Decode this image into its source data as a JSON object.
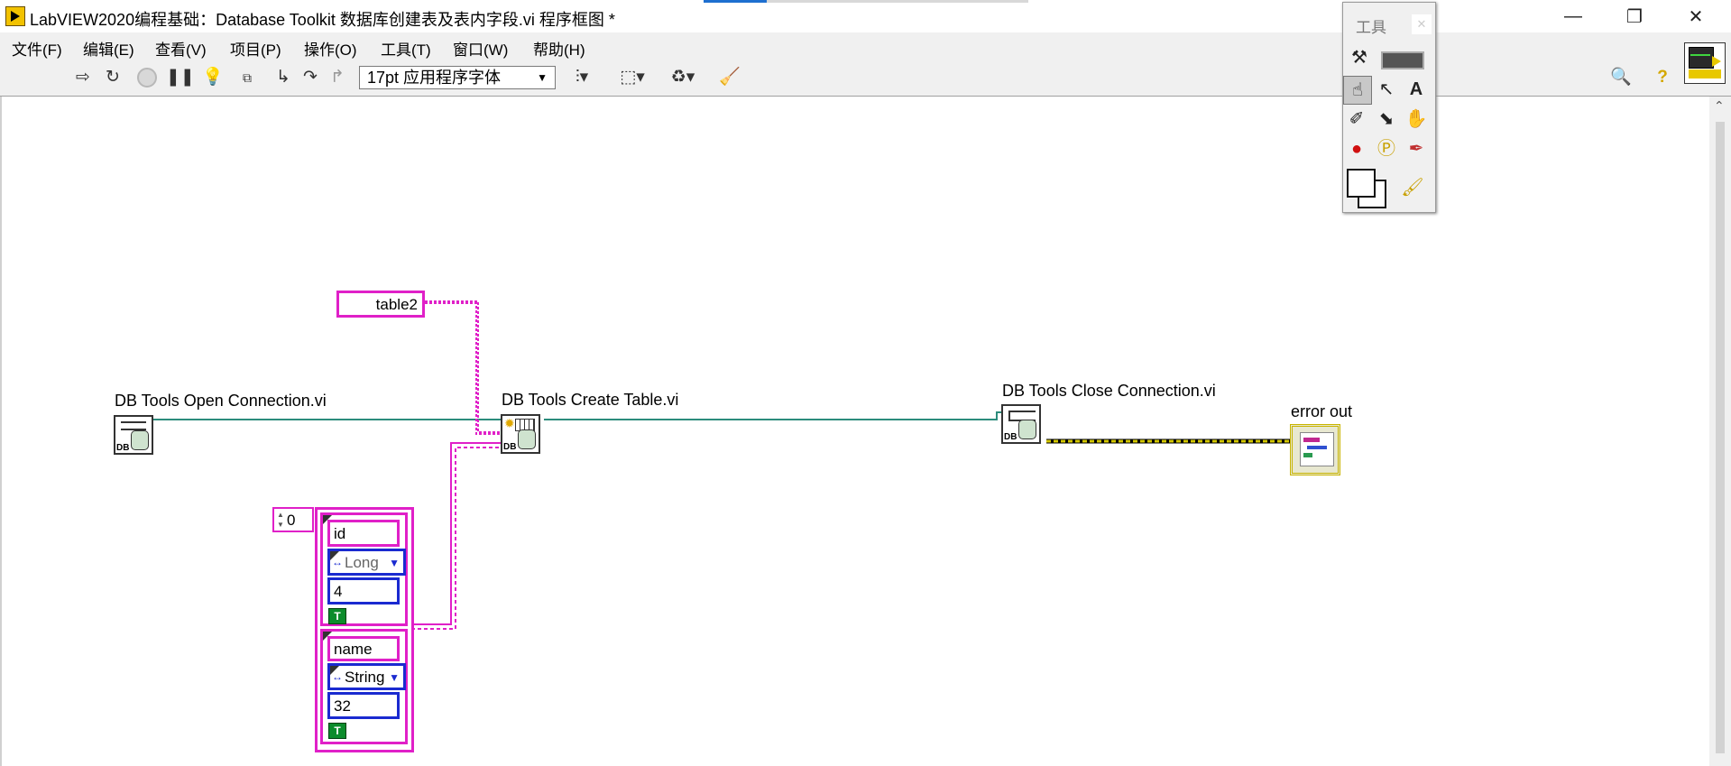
{
  "window": {
    "title": "LabVIEW2020编程基础：Database Toolkit 数据库创建表及表内字段.vi 程序框图 *",
    "minimize_icon": "minimize-icon",
    "maximize_icon": "restore-icon",
    "close_icon": "close-icon"
  },
  "menu": [
    "文件(F)",
    "编辑(E)",
    "查看(V)",
    "项目(P)",
    "操作(O)",
    "工具(T)",
    "窗口(W)",
    "帮助(H)"
  ],
  "toolbar": {
    "font": "17pt 应用程序字体",
    "icons": [
      "run-arrow-icon",
      "run-continuously-icon",
      "abort-icon",
      "pause-icon",
      "highlight-execution-icon",
      "retain-wire-values-icon",
      "step-into-icon",
      "step-over-icon",
      "step-out-icon",
      "align-icon",
      "distribute-icon",
      "reorder-icon",
      "clean-diagram-icon",
      "search-icon",
      "help-icon"
    ]
  },
  "tools_palette": {
    "title": "工具",
    "tools": [
      "automatic-tool-icon",
      "operate-value-icon",
      "position-select-icon",
      "edit-text-icon",
      "connect-wire-icon",
      "object-shortcut-menu-icon",
      "scroll-window-icon",
      "breakpoint-icon",
      "probe-icon",
      "get-color-icon",
      "set-color-icon"
    ]
  },
  "diagram": {
    "nodes": {
      "open_connection": "DB Tools Open Connection.vi",
      "create_table": "DB Tools Create Table.vi",
      "close_connection": "DB Tools Close Connection.vi",
      "error_out": "error out"
    },
    "table_name_constant": "table2",
    "array_index": "0",
    "db_badge": "DB",
    "columns": [
      {
        "name": "id",
        "type": "Long",
        "size": "4",
        "bool_glyph": "T"
      },
      {
        "name": "name",
        "type": "String",
        "size": "32",
        "bool_glyph": "T"
      }
    ],
    "colors": {
      "string_wire": "#e020c8",
      "refnum_wire": "#2c8c7c",
      "error_wire": "#d4c800",
      "enum_border": "#1a2ad0"
    }
  }
}
